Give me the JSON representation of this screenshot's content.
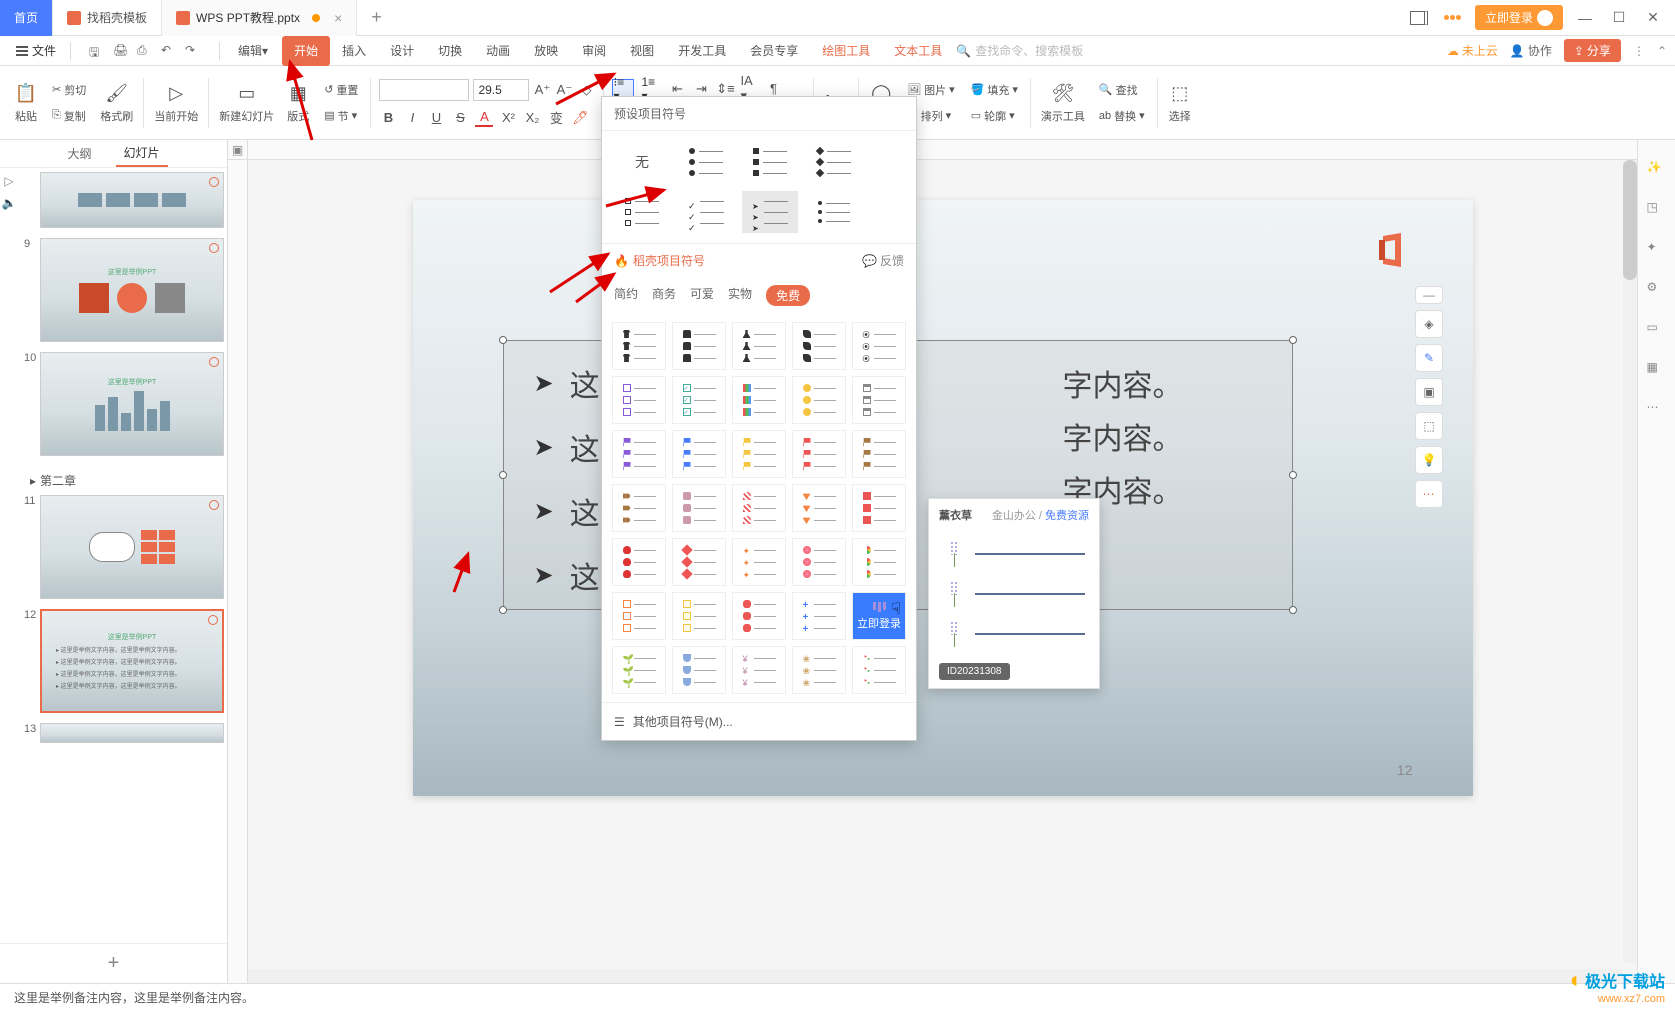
{
  "tabs": {
    "home": "首页",
    "template": "找稻壳模板",
    "current": "WPS PPT教程.pptx",
    "add": "+"
  },
  "title_right": {
    "login": "立即登录"
  },
  "menubar": {
    "file": "文件",
    "edit": "编辑",
    "tabs": [
      "开始",
      "插入",
      "设计",
      "切换",
      "动画",
      "放映",
      "审阅",
      "视图",
      "开发工具",
      "会员专享"
    ],
    "extra_tabs": [
      "绘图工具",
      "文本工具"
    ],
    "search_placeholder": "查找命令、搜索模板",
    "cloud": "未上云",
    "collab": "协作",
    "share": "分享"
  },
  "toolbar": {
    "paste": "粘贴",
    "cut": "剪切",
    "copy": "复制",
    "format_painter": "格式刷",
    "from_current": "当前开始",
    "new_slide": "新建幻灯片",
    "layout": "版式",
    "reset": "重置",
    "section": "节",
    "font_size": "29.5",
    "shapes": "形状",
    "picture": "图片",
    "fill": "填充",
    "arrange": "排列",
    "outline": "轮廓",
    "align_text": "对齐文本",
    "presentation_tools": "演示工具",
    "find": "查找",
    "replace": "替换",
    "select": "选择"
  },
  "outline": {
    "tabs": [
      "大纲",
      "幻灯片"
    ],
    "chapter": "第二章",
    "slide_nums": [
      "9",
      "10",
      "11",
      "12",
      "13"
    ],
    "thumb_title": "这里是举例PPT"
  },
  "slide": {
    "text_lines": [
      "这里是举例文",
      "这里是举例文",
      "这里是举例文",
      "这里是举例文"
    ],
    "text_suffix": "字内容。",
    "page_num": "12"
  },
  "bullet_dropdown": {
    "header": "预设项目符号",
    "none": "无",
    "brand": "稻壳项目符号",
    "feedback": "反馈",
    "categories": [
      "简约",
      "商务",
      "可爱",
      "实物",
      "免费"
    ],
    "login_now": "立即登录",
    "other": "其他项目符号(M)..."
  },
  "preview": {
    "name": "薰衣草",
    "source": "金山办公",
    "link": "免费资源",
    "id": "ID20231308"
  },
  "statusbar": {
    "notes": "这里是举例备注内容，这里是举例备注内容。"
  },
  "watermark": {
    "name": "极光下载站",
    "url": "www.xz7.com"
  }
}
